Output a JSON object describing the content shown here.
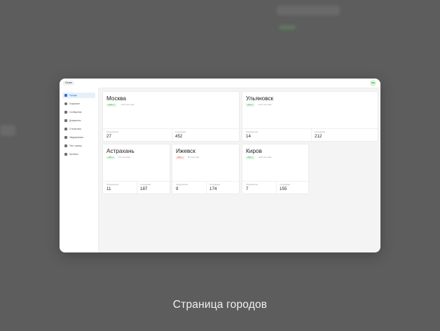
{
  "app": {
    "logo_text": "Остин",
    "avatar_initials": "ЮК"
  },
  "sidebar": {
    "items": [
      {
        "label": "Города",
        "icon": "city-icon",
        "active": true
      },
      {
        "label": "Хозрасчет",
        "icon": "clock-icon",
        "active": false
      },
      {
        "label": "Сообщения",
        "icon": "mail-icon",
        "active": false
      },
      {
        "label": "Документы",
        "icon": "document-icon",
        "active": false
      },
      {
        "label": "Статистика",
        "icon": "chart-icon",
        "active": false
      },
      {
        "label": "Уведомления",
        "icon": "bell-icon",
        "active": false
      },
      {
        "label": "Тест-трекер",
        "icon": "check-icon",
        "active": false
      },
      {
        "label": "Проекты",
        "icon": "folder-icon",
        "active": false
      }
    ]
  },
  "cities": [
    {
      "name": "Москва",
      "badge": "+14% ↗",
      "badge_type": "up",
      "note": "+15% чем в мае",
      "stat1_label": "Предприятия",
      "stat1_value": "27",
      "stat2_label": "Сотрудники",
      "stat2_value": "452"
    },
    {
      "name": "Ульяновск",
      "badge": "+9% ↗",
      "badge_type": "up",
      "note": "+12% чем в мае",
      "stat1_label": "Предприятия",
      "stat1_value": "14",
      "stat2_label": "Сотрудники",
      "stat2_value": "212"
    },
    {
      "name": "Астрахань",
      "badge": "+6% ↗",
      "badge_type": "up",
      "note": "+7% чем в мае",
      "stat1_label": "Предприятия",
      "stat1_value": "11",
      "stat2_label": "Сотрудники",
      "stat2_value": "187"
    },
    {
      "name": "Ижевск",
      "badge": "-3% ↘",
      "badge_type": "down",
      "note": "-5% чем в мае",
      "stat1_label": "Предприятия",
      "stat1_value": "9",
      "stat2_label": "Сотрудники",
      "stat2_value": "174"
    },
    {
      "name": "Киров",
      "badge": "+5% ↗",
      "badge_type": "up",
      "note": "+12% чем в мае",
      "stat1_label": "Предприятия",
      "stat1_value": "7",
      "stat2_label": "Сотрудники",
      "stat2_value": "155"
    }
  ],
  "caption": "Страница городов"
}
